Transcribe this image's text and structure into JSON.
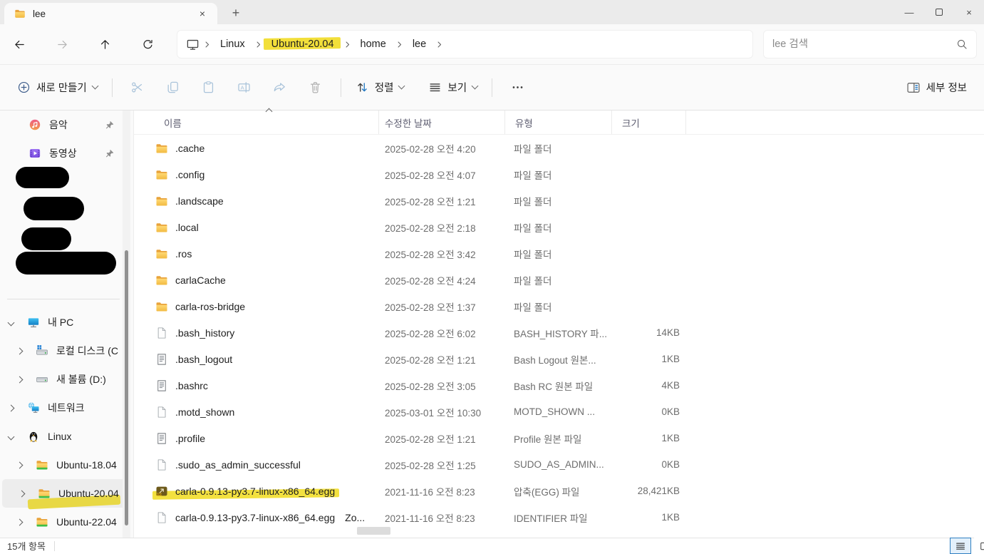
{
  "window": {
    "tab_title": "lee",
    "controls": {
      "minimize_icon": "minimize-icon",
      "maximize_icon": "maximize-icon",
      "close_icon": "close-icon"
    },
    "tab_close_icon": "close-icon",
    "new_tab_icon": "plus-icon"
  },
  "nav": {
    "back_icon": "arrow-left-icon",
    "forward_icon": "arrow-right-icon",
    "up_icon": "arrow-up-icon",
    "refresh_icon": "refresh-icon",
    "location_icon": "monitor-icon",
    "breadcrumbs": [
      {
        "label": "Linux",
        "highlighted": false
      },
      {
        "label": "Ubuntu-20.04",
        "highlighted": true
      },
      {
        "label": "home",
        "highlighted": false
      },
      {
        "label": "lee",
        "highlighted": false
      }
    ],
    "search_placeholder": "lee 검색",
    "search_icon": "search-icon",
    "highlight_color": "#f2df3a"
  },
  "toolbar": {
    "new_label": "새로 만들기",
    "sort_label": "정렬",
    "view_label": "보기",
    "details_label": "세부 정보",
    "disabled_icons": [
      "cut-icon",
      "copy-icon",
      "paste-icon",
      "rename-icon",
      "share-icon",
      "delete-icon"
    ],
    "more_icon": "ellipsis-icon"
  },
  "sidebar": {
    "pinned": [
      {
        "label": "음악",
        "icon": "music",
        "pinned": true
      },
      {
        "label": "동영상",
        "icon": "video",
        "pinned": true
      }
    ],
    "redacted_count": 4,
    "tree": [
      {
        "label": "내 PC",
        "icon": "pc",
        "level": 0,
        "expanded": true,
        "selected": false,
        "highlighted": false
      },
      {
        "label": "로컬 디스크 (C",
        "icon": "diskwin",
        "level": 1,
        "expanded": false,
        "selected": false,
        "highlighted": false
      },
      {
        "label": "새 볼륨 (D:)",
        "icon": "disk",
        "level": 1,
        "expanded": false,
        "selected": false,
        "highlighted": false
      },
      {
        "label": "네트워크",
        "icon": "network",
        "level": 0,
        "expanded": false,
        "selected": false,
        "highlighted": false
      },
      {
        "label": "Linux",
        "icon": "tux",
        "level": 0,
        "expanded": true,
        "selected": false,
        "highlighted": false
      },
      {
        "label": "Ubuntu-18.04",
        "icon": "folderlinux",
        "level": 1,
        "expanded": false,
        "selected": false,
        "highlighted": false
      },
      {
        "label": "Ubuntu-20.04",
        "icon": "folderlinux",
        "level": 1,
        "expanded": false,
        "selected": true,
        "highlighted": true
      },
      {
        "label": "Ubuntu-22.04",
        "icon": "folderlinux",
        "level": 1,
        "expanded": false,
        "selected": false,
        "highlighted": false
      }
    ]
  },
  "files": {
    "columns": [
      "이름",
      "수정한 날짜",
      "유형",
      "크기"
    ],
    "sort_ascending_on": "이름",
    "rows": [
      {
        "name": ".cache",
        "date": "2025-02-28 오전 4:20",
        "type": "파일 폴더",
        "size": "",
        "icon": "folder",
        "highlighted": false,
        "name_suffix": ""
      },
      {
        "name": ".config",
        "date": "2025-02-28 오전 4:07",
        "type": "파일 폴더",
        "size": "",
        "icon": "folder",
        "highlighted": false,
        "name_suffix": ""
      },
      {
        "name": ".landscape",
        "date": "2025-02-28 오전 1:21",
        "type": "파일 폴더",
        "size": "",
        "icon": "folder",
        "highlighted": false,
        "name_suffix": ""
      },
      {
        "name": ".local",
        "date": "2025-02-28 오전 2:18",
        "type": "파일 폴더",
        "size": "",
        "icon": "folder",
        "highlighted": false,
        "name_suffix": ""
      },
      {
        "name": ".ros",
        "date": "2025-02-28 오전 3:42",
        "type": "파일 폴더",
        "size": "",
        "icon": "folder",
        "highlighted": false,
        "name_suffix": ""
      },
      {
        "name": "carlaCache",
        "date": "2025-02-28 오전 4:24",
        "type": "파일 폴더",
        "size": "",
        "icon": "folder",
        "highlighted": false,
        "name_suffix": ""
      },
      {
        "name": "carla-ros-bridge",
        "date": "2025-02-28 오전 1:37",
        "type": "파일 폴더",
        "size": "",
        "icon": "folder",
        "highlighted": false,
        "name_suffix": ""
      },
      {
        "name": ".bash_history",
        "date": "2025-02-28 오전 6:02",
        "type": "BASH_HISTORY 파...",
        "size": "14KB",
        "icon": "fileplain",
        "highlighted": false,
        "name_suffix": ""
      },
      {
        "name": ".bash_logout",
        "date": "2025-02-28 오전 1:21",
        "type": "Bash Logout 원본...",
        "size": "1KB",
        "icon": "filedoc",
        "highlighted": false,
        "name_suffix": ""
      },
      {
        "name": ".bashrc",
        "date": "2025-02-28 오전 3:05",
        "type": "Bash RC 원본 파일",
        "size": "4KB",
        "icon": "filedoc",
        "highlighted": false,
        "name_suffix": ""
      },
      {
        "name": ".motd_shown",
        "date": "2025-03-01 오전 10:30",
        "type": "MOTD_SHOWN ...",
        "size": "0KB",
        "icon": "fileplain",
        "highlighted": false,
        "name_suffix": ""
      },
      {
        "name": ".profile",
        "date": "2025-02-28 오전 1:21",
        "type": "Profile 원본 파일",
        "size": "1KB",
        "icon": "filedoc",
        "highlighted": false,
        "name_suffix": ""
      },
      {
        "name": ".sudo_as_admin_successful",
        "date": "2025-02-28 오전 1:25",
        "type": "SUDO_AS_ADMIN...",
        "size": "0KB",
        "icon": "fileplain",
        "highlighted": false,
        "name_suffix": ""
      },
      {
        "name": "carla-0.9.13-py3.7-linux-x86_64.egg",
        "date": "2021-11-16 오전 8:23",
        "type": "압축(EGG) 파일",
        "size": "28,421KB",
        "icon": "egg",
        "highlighted": true,
        "name_suffix": ""
      },
      {
        "name": "carla-0.9.13-py3.7-linux-x86_64.egg",
        "date": "2021-11-16 오전 8:23",
        "type": "IDENTIFIER 파일",
        "size": "1KB",
        "icon": "fileplain",
        "highlighted": false,
        "name_suffix": "Zo..."
      }
    ]
  },
  "statusbar": {
    "item_count": "15개 항목",
    "view_details_icon": "details-view-icon",
    "view_thumb_icon": "thumbnail-view-icon"
  }
}
